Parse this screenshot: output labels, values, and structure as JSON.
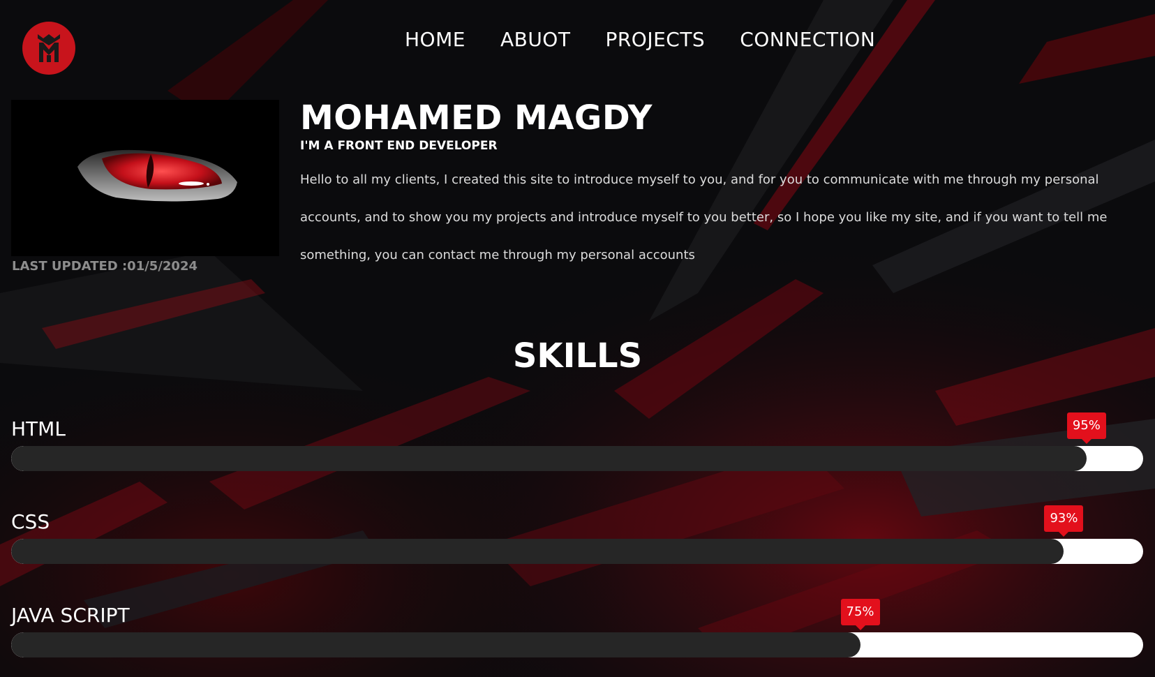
{
  "header": {
    "logo_icon": "mm-monogram-icon",
    "nav": [
      {
        "label": "HOME"
      },
      {
        "label": "ABUOT"
      },
      {
        "label": "PROJECTS"
      },
      {
        "label": "CONNECTION"
      }
    ]
  },
  "profile": {
    "image_icon": "red-eye-image",
    "last_updated": "LAST UPDATED :01/5/2024",
    "name": "MOHAMED MAGDY",
    "role": "I'M A FRONT END DEVELOPER",
    "bio": "Hello to all my clients, I created this site to introduce myself to you, and for you to communicate with me through my personal accounts, and to show you my projects and introduce myself to you better, so I hope you like my site, and if you want to tell me something, you can contact me through my personal accounts"
  },
  "skills": {
    "title": "SKILLS",
    "items": [
      {
        "name": "HTML",
        "percent": 95,
        "label": "95%"
      },
      {
        "name": "CSS",
        "percent": 93,
        "label": "93%"
      },
      {
        "name": "JAVA SCRIPT",
        "percent": 75,
        "label": "75%"
      }
    ]
  },
  "colors": {
    "accent": "#e3101c",
    "logo": "#c8141c",
    "bar_fill": "#262626",
    "bar_track": "#ffffff",
    "background": "#0a0a0c"
  }
}
